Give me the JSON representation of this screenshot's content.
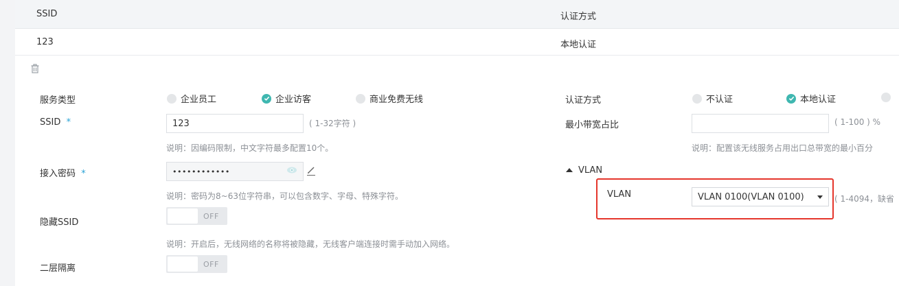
{
  "table": {
    "columns": [
      "SSID",
      "认证方式"
    ],
    "rows": [
      [
        "123",
        "本地认证"
      ]
    ]
  },
  "form": {
    "service_type": {
      "label": "服务类型",
      "options": [
        "企业员工",
        "企业访客",
        "商业免费无线"
      ],
      "selected": "企业访客"
    },
    "ssid": {
      "label": "SSID",
      "required_mark": "*",
      "value": "123",
      "range": "( 1-32字符 )",
      "hint": "说明：因编码限制，中文字符最多配置10个。"
    },
    "password": {
      "label": "接入密码",
      "required_mark": "*",
      "value": "••••••••••••",
      "hint": "说明：密码为8~63位字符串，可以包含数字、字母、特殊字符。"
    },
    "hide_ssid": {
      "label": "隐藏SSID",
      "state": "OFF",
      "hint": "说明：开启后，无线网络的名称将被隐藏，无线客户端连接时需手动加入网络。"
    },
    "l2_isolation": {
      "label": "二层隔离",
      "state": "OFF"
    },
    "auth_method": {
      "label": "认证方式",
      "options": [
        "不认证",
        "本地认证"
      ],
      "selected": "本地认证"
    },
    "min_bandwidth": {
      "label": "最小带宽占比",
      "value": "",
      "range": "( 1-100 ) %",
      "hint": "说明：配置该无线服务占用出口总带宽的最小百分"
    },
    "vlan_section": {
      "toggle_label": "VLAN",
      "label": "VLAN",
      "selected": "VLAN 0100(VLAN 0100)",
      "range": "( 1-4094，缺省"
    }
  },
  "colors": {
    "accent": "#3fb7b0",
    "highlight": "#e5352b",
    "required": "#2aa3d6"
  }
}
